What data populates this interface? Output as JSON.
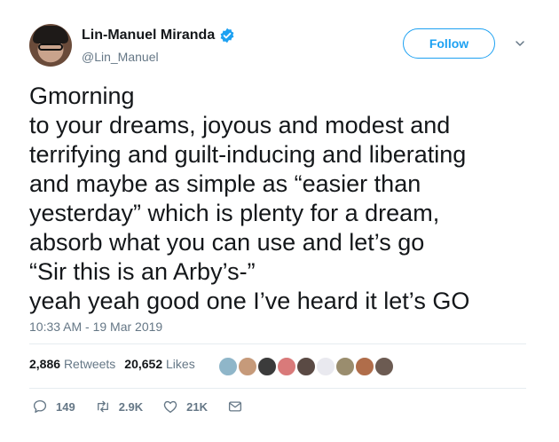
{
  "author": {
    "display_name": "Lin-Manuel Miranda",
    "handle": "@Lin_Manuel",
    "verified": true
  },
  "follow_label": "Follow",
  "tweet_text": "Gmorning\nto your dreams, joyous and modest and\nterrifying and guilt-inducing and liberating\nand maybe as simple as “easier than\nyesterday” which is plenty for a dream,\nabsorb what you can use and let’s go\n“Sir this is an Arby’s-”\nyeah yeah good one I’ve heard it let’s GO",
  "timestamp": "10:33 AM - 19 Mar 2019",
  "stats": {
    "retweets_count": "2,886",
    "retweets_label": "Retweets",
    "likes_count": "20,652",
    "likes_label": "Likes"
  },
  "actions": {
    "replies": "149",
    "retweets": "2.9K",
    "likes": "21K"
  },
  "colors": {
    "accent": "#1da1f2",
    "text": "#14171a",
    "muted": "#657786"
  },
  "likers": [
    {
      "color": "#8fb6c9"
    },
    {
      "color": "#c69a7a"
    },
    {
      "color": "#3b3b3b"
    },
    {
      "color": "#d97a7a"
    },
    {
      "color": "#5a4a44"
    },
    {
      "color": "#e9e9ef"
    },
    {
      "color": "#9a8d6e"
    },
    {
      "color": "#b06d4a"
    },
    {
      "color": "#6c5b52"
    }
  ]
}
